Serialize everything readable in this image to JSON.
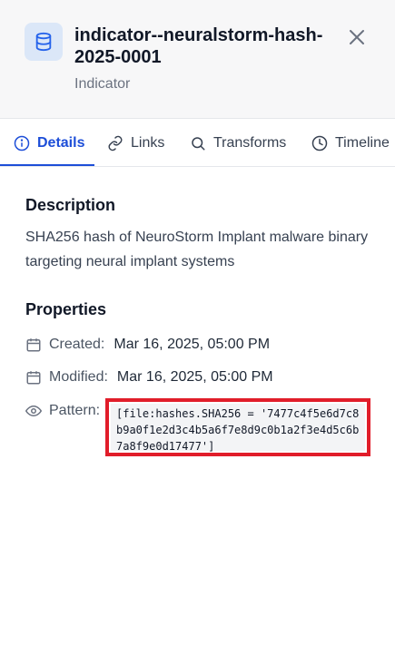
{
  "header": {
    "title": "indicator--neuralstorm-hash-2025-0001",
    "subtitle": "Indicator",
    "entity_icon": "database-icon",
    "close_icon": "close-icon"
  },
  "tabs": [
    {
      "label": "Details",
      "icon": "info-icon",
      "active": true
    },
    {
      "label": "Links",
      "icon": "link-icon",
      "active": false
    },
    {
      "label": "Transforms",
      "icon": "search-icon",
      "active": false
    },
    {
      "label": "Timeline",
      "icon": "clock-icon",
      "active": false
    }
  ],
  "description": {
    "heading": "Description",
    "text": "SHA256 hash of NeuroStorm Implant malware binary targeting neural implant systems"
  },
  "properties": {
    "heading": "Properties",
    "created": {
      "label": "Created:",
      "value": "Mar 16, 2025, 05:00 PM",
      "icon": "calendar-icon"
    },
    "modified": {
      "label": "Modified:",
      "value": "Mar 16, 2025, 05:00 PM",
      "icon": "calendar-icon"
    },
    "pattern": {
      "label": "Pattern:",
      "value": "[file:hashes.SHA256 = '7477c4f5e6d7c8b9a0f1e2d3c4b5a6f7e8d9c0b1a2f3e4d5c6b7a8f9e0d17477']",
      "icon": "eye-icon"
    }
  },
  "colors": {
    "accent": "#1d4ed8",
    "highlight_border": "#e11d2a"
  }
}
